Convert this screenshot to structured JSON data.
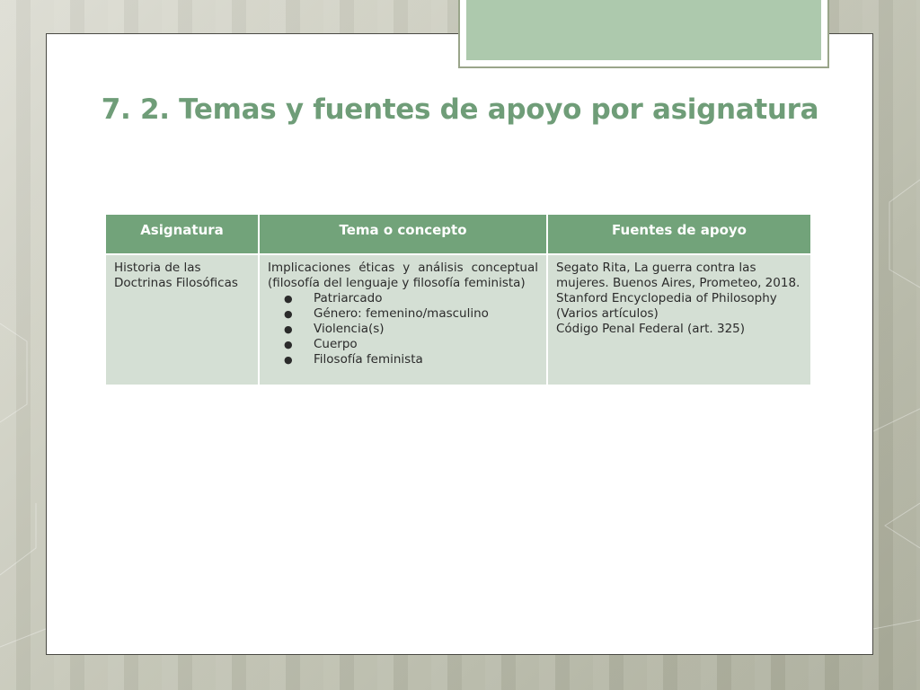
{
  "title": "7. 2. Temas y fuentes de apoyo por asignatura",
  "table": {
    "headers": [
      "Asignatura",
      "Tema o concepto",
      "Fuentes de apoyo"
    ],
    "row": {
      "asignatura": [
        "Historia de las",
        "Doctrinas Filosóficas"
      ],
      "tema_intro": [
        "Implicaciones éticas y análisis conceptual",
        "(filosofía del lenguaje y filosofía feminista)"
      ],
      "tema_items": [
        "Patriarcado",
        "Género: femenino/masculino",
        "Violencia(s)",
        "Cuerpo",
        "Filosofía feminista"
      ],
      "fuentes": [
        "Segato Rita, La guerra contra las",
        "mujeres. Buenos Aires, Prometeo, 2018.",
        "Stanford Encyclopedia of Philosophy",
        "(Varios artículos)",
        "Código Penal Federal (art. 325)"
      ]
    }
  },
  "colors": {
    "title": "#6f9d78",
    "header_bg": "#72a37a",
    "cell_bg": "#d4dfd4",
    "title_box": "#adc9ad"
  }
}
